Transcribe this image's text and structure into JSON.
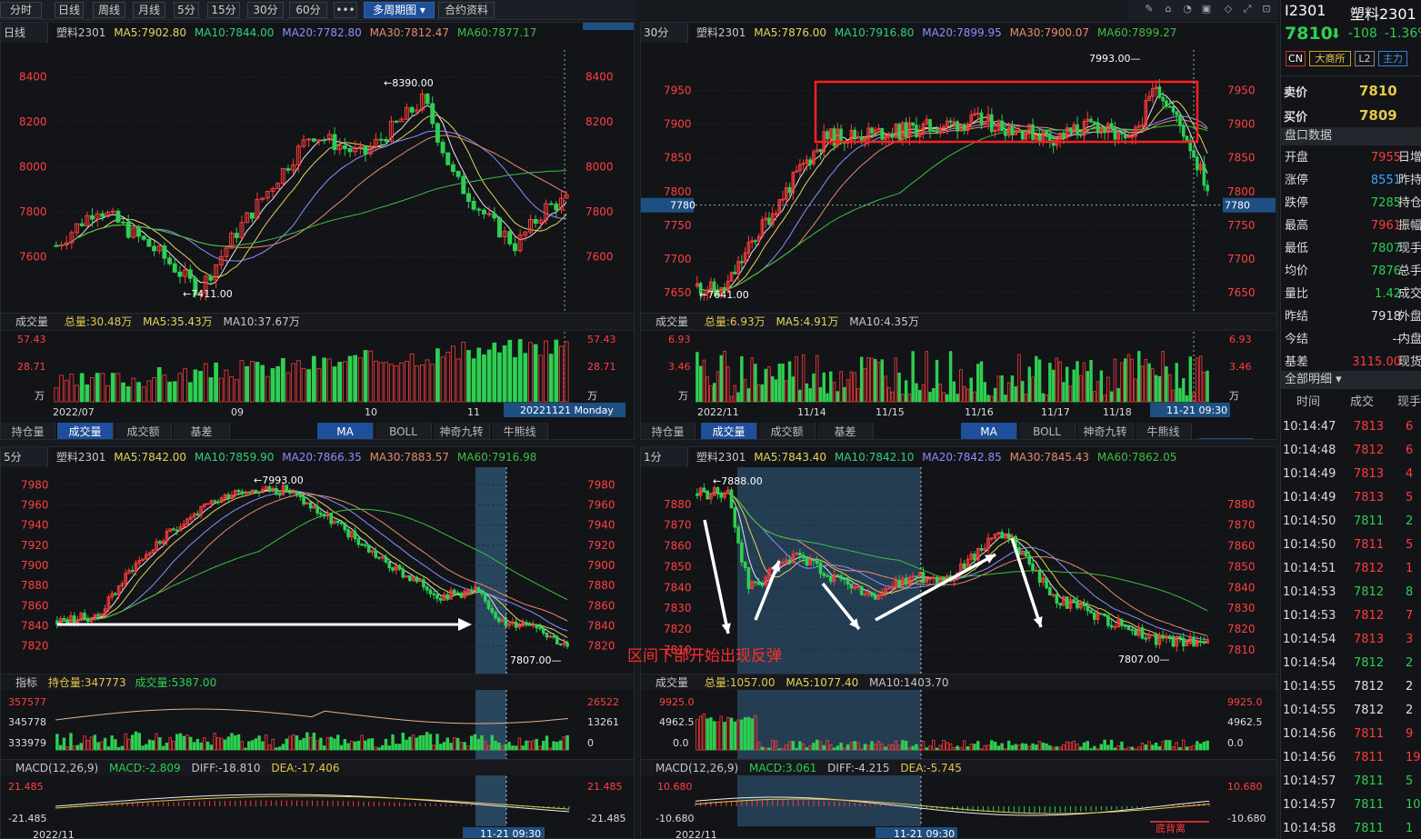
{
  "toolbar": {
    "buttons": [
      "分时",
      "日线",
      "周线",
      "月线",
      "5分",
      "15分",
      "30分",
      "60分",
      "•••",
      "多周期图 ▾",
      "合约资料"
    ],
    "active_index": 9,
    "tools": [
      "✎",
      "⌂",
      "◔",
      "▣",
      "◇",
      "⤢",
      "⊡"
    ]
  },
  "panels": {
    "p1": {
      "period": "日线",
      "symbol": "塑料2301",
      "ma": {
        "ma5": "MA5:7902.80",
        "ma10": "MA10:7844.00",
        "ma20": "MA20:7782.80",
        "ma30": "MA30:7812.47",
        "ma60": "MA60:7877.17"
      },
      "price_ticks": [
        "8400",
        "8200",
        "8000",
        "7800",
        "7600"
      ],
      "hi_label": "8390.00",
      "lo_label": "7411.00",
      "vol": {
        "title": "成交量",
        "total": "总量:30.48万",
        "ma5": "MA5:35.43万",
        "ma10": "MA10:37.67万",
        "ticks": [
          "57.43",
          "28.71"
        ],
        "unit": "万"
      },
      "dates": [
        "2022/07",
        "09",
        "10",
        "11"
      ],
      "cursor_label": "20221121 Monday",
      "tabs": [
        "持仓量",
        "成交量",
        "成交额",
        "基差"
      ],
      "indicator_tabs": [
        "MA",
        "BOLL",
        "神奇九转",
        "牛熊线"
      ]
    },
    "p2": {
      "period": "30分",
      "symbol": "塑料2301",
      "ma": {
        "ma5": "MA5:7876.00",
        "ma10": "MA10:7916.80",
        "ma20": "MA20:7899.95",
        "ma30": "MA30:7900.07",
        "ma60": "MA60:7899.27"
      },
      "price_ticks": [
        "7950",
        "7900",
        "7850",
        "7800",
        "7750",
        "7700",
        "7650"
      ],
      "hi_label": "7993.00",
      "lo_label": "7641.00",
      "cursor_price": "7780",
      "vol": {
        "title": "成交量",
        "total": "总量:6.93万",
        "ma5": "MA5:4.91万",
        "ma10": "MA10:4.35万",
        "ticks": [
          "6.93",
          "3.46"
        ],
        "unit": "万"
      },
      "dates": [
        "2022/11",
        "11/14",
        "11/15",
        "11/16",
        "11/17",
        "11/18"
      ],
      "cursor_label": "11-21 09:30",
      "tabs": [
        "持仓量",
        "成交量",
        "成交额",
        "基差"
      ],
      "indicator_tabs": [
        "MA",
        "BOLL",
        "神奇九转",
        "牛熊线"
      ]
    },
    "p3": {
      "period": "5分",
      "symbol": "塑料2301",
      "ma": {
        "ma5": "MA5:7842.00",
        "ma10": "MA10:7859.90",
        "ma20": "MA20:7866.35",
        "ma30": "MA30:7883.57",
        "ma60": "MA60:7916.98"
      },
      "price_ticks": [
        "7980",
        "7960",
        "7940",
        "7920",
        "7900",
        "7880",
        "7860",
        "7840",
        "7820"
      ],
      "hi_label": "7993.00",
      "lo_label": "7807.00",
      "ind": {
        "title": "指标",
        "oi": "持仓量:347773",
        "vol": "成交量:5387.00",
        "left_ticks": [
          "357577",
          "345778",
          "333979"
        ],
        "right_ticks": [
          "26522",
          "13261",
          "0"
        ]
      },
      "macd": {
        "title": "MACD(12,26,9)",
        "macd": "MACD:-2.809",
        "diff": "DIFF:-18.810",
        "dea": "DEA:-17.406",
        "ticks": [
          "21.485",
          "-21.485"
        ]
      },
      "dates": [
        "2022/11"
      ],
      "cursor_label": "11-21 09:30"
    },
    "p4": {
      "period": "1分",
      "symbol": "塑料2301",
      "ma": {
        "ma5": "MA5:7843.40",
        "ma10": "MA10:7842.10",
        "ma20": "MA20:7842.85",
        "ma30": "MA30:7845.43",
        "ma60": "MA60:7862.05"
      },
      "price_ticks": [
        "7880",
        "7870",
        "7860",
        "7850",
        "7840",
        "7830",
        "7820",
        "7810"
      ],
      "hi_label": "7888.00",
      "lo_label": "7807.00",
      "vol": {
        "title": "成交量",
        "total": "总量:1057.00",
        "ma5": "MA5:1077.40",
        "ma10": "MA10:1403.70",
        "ticks": [
          "9925.0",
          "4962.5",
          "0.0"
        ]
      },
      "macd": {
        "title": "MACD(12,26,9)",
        "macd": "MACD:3.061",
        "diff": "DIFF:-4.215",
        "dea": "DEA:-5.745",
        "ticks": [
          "10.680",
          "-10.680"
        ]
      },
      "dates": [
        "2022/11"
      ],
      "cursor_label": "11-21 09:30",
      "bottom_tag": "底背离"
    }
  },
  "annotation": "区间下部开始出现反弹",
  "right_panel": {
    "code": "I2301",
    "name": "塑料2301",
    "price": "7810",
    "arrow": "⬇",
    "change": "-108",
    "pct": "-1.36%",
    "tags": [
      "CN",
      "大商所",
      "L2",
      "主力"
    ],
    "ask_label": "卖价",
    "ask": "7810",
    "bid_label": "买价",
    "bid": "7809",
    "section": "盘口数据",
    "rows": [
      {
        "label": "开盘",
        "value": "7955",
        "tail": "日增",
        "color": "up"
      },
      {
        "label": "涨停",
        "value": "8551",
        "tail": "昨持",
        "color": "blue"
      },
      {
        "label": "跌停",
        "value": "7285",
        "tail": "持仓",
        "color": "dn"
      },
      {
        "label": "最高",
        "value": "7961",
        "tail": "振幅",
        "color": "up"
      },
      {
        "label": "最低",
        "value": "7807",
        "tail": "现手",
        "color": "dn"
      },
      {
        "label": "均价",
        "value": "7876",
        "tail": "总手",
        "color": "dn"
      },
      {
        "label": "量比",
        "value": "1.42",
        "tail": "成交",
        "color": "dn"
      },
      {
        "label": "昨结",
        "value": "7918",
        "tail": "外盘",
        "color": "white"
      },
      {
        "label": "今结",
        "value": "--",
        "tail": "内盘",
        "color": "white"
      },
      {
        "label": "基差",
        "value": "3115.00",
        "tail": "现货",
        "color": "up"
      }
    ],
    "detail_label": "全部明细 ▾",
    "cols": [
      "时间",
      "成交",
      "现手"
    ],
    "trades": [
      [
        "10:14:47",
        "7813",
        "6"
      ],
      [
        "10:14:48",
        "7812",
        "6"
      ],
      [
        "10:14:49",
        "7813",
        "4"
      ],
      [
        "10:14:49",
        "7813",
        "5"
      ],
      [
        "10:14:50",
        "7811",
        "2"
      ],
      [
        "10:14:50",
        "7811",
        "5"
      ],
      [
        "10:14:51",
        "7812",
        "1"
      ],
      [
        "10:14:53",
        "7812",
        "8"
      ],
      [
        "10:14:53",
        "7812",
        "7"
      ],
      [
        "10:14:54",
        "7813",
        "3"
      ],
      [
        "10:14:54",
        "7812",
        "2"
      ],
      [
        "10:14:55",
        "7812",
        "2"
      ],
      [
        "10:14:55",
        "7812",
        "2"
      ],
      [
        "10:14:56",
        "7811",
        "9"
      ],
      [
        "10:14:56",
        "7811",
        "19"
      ],
      [
        "10:14:57",
        "7811",
        "5"
      ],
      [
        "10:14:57",
        "7811",
        "10"
      ],
      [
        "10:14:58",
        "7811",
        "1"
      ]
    ],
    "trade_colors": [
      "up",
      "up",
      "up",
      "up",
      "dn",
      "up",
      "up",
      "dn",
      "up",
      "up",
      "dn",
      "white",
      "white",
      "up",
      "up",
      "dn",
      "dn",
      "dn"
    ]
  }
}
